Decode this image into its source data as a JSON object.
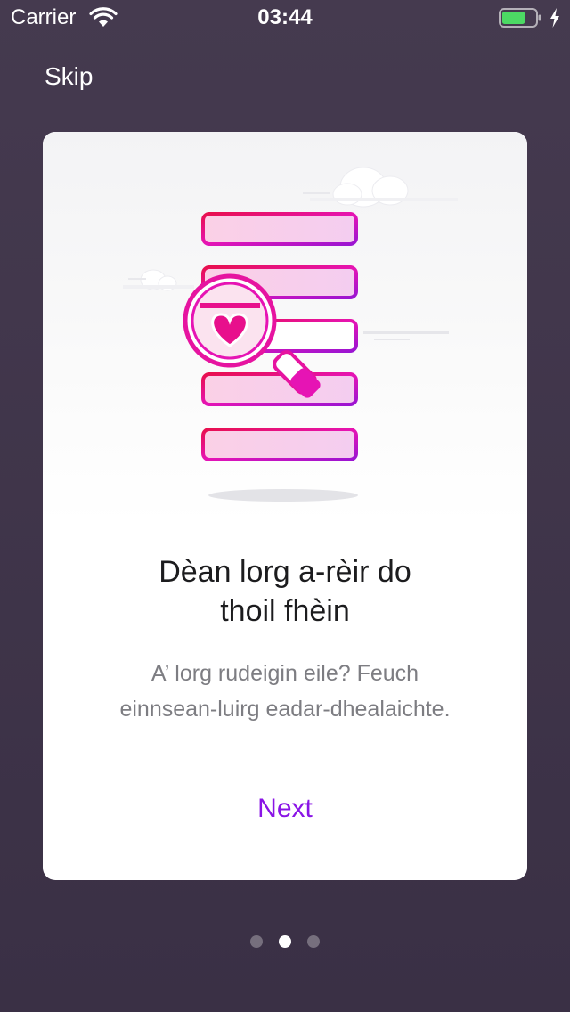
{
  "status_bar": {
    "carrier": "Carrier",
    "time": "03:44",
    "battery_level": 0.7,
    "battery_color": "#4cd964",
    "icons": [
      "wifi-icon",
      "battery-icon",
      "charging-bolt-icon"
    ]
  },
  "header": {
    "skip_label": "Skip"
  },
  "card": {
    "illustration": "search-list-magnifier-heart-illustration",
    "title_line1": "Dèan lorg a-rèir do",
    "title_line2": "thoil fhèin",
    "subtitle_line1": "A’ lorg rudeigin eile? Feuch",
    "subtitle_line2": "einnsean-luirg eadar-dhealaichte.",
    "next_label": "Next"
  },
  "pagination": {
    "total": 3,
    "current": 2
  },
  "colors": {
    "background": "#42384c",
    "accent": "#8a14e6",
    "illustration_pink": "#e6148c",
    "illustration_magenta": "#c80fbe"
  }
}
